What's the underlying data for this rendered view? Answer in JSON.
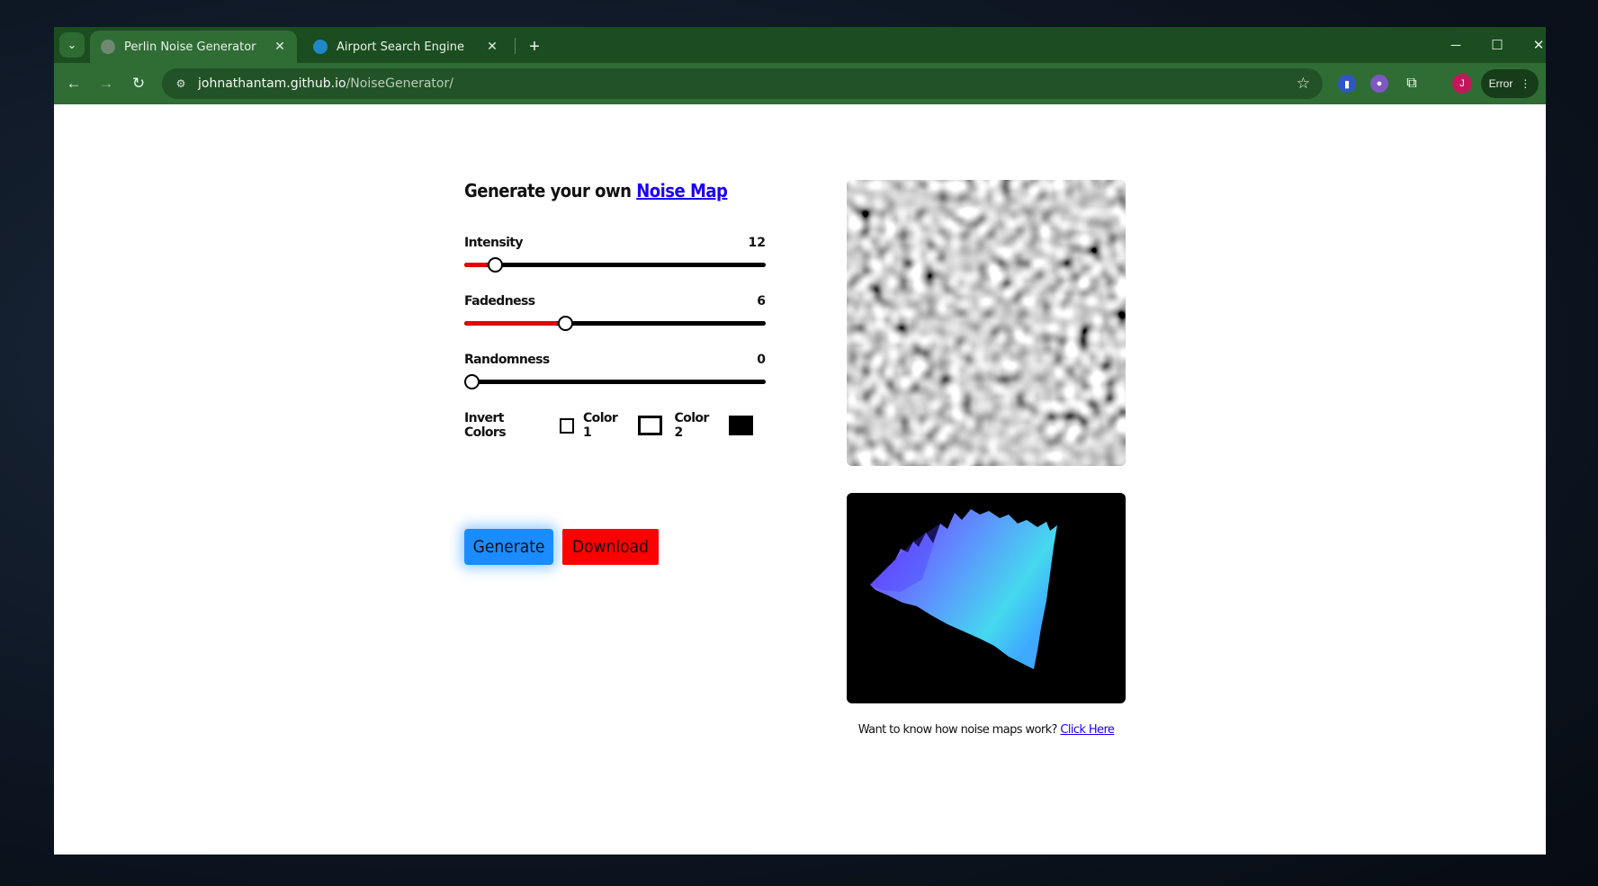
{
  "browser": {
    "tabs": [
      {
        "title": "Perlin Noise Generator",
        "active": true,
        "icon": "globe-icon"
      },
      {
        "title": "Airport Search Engine",
        "active": false,
        "icon": "x-badge-icon"
      }
    ],
    "new_tab_label": "+",
    "url_host": "johnathantam.github.io",
    "url_path": "/NoiseGenerator/",
    "profile_initial": "J",
    "error_label": "Error",
    "accent_color": "#2f6d34"
  },
  "page": {
    "heading_prefix": "Generate your own ",
    "heading_link": "Noise Map",
    "sliders": [
      {
        "label": "Intensity",
        "value": "12",
        "fraction": 0.077
      },
      {
        "label": "Fadedness",
        "value": "6",
        "fraction": 0.31
      },
      {
        "label": "Randomness",
        "value": "0",
        "fraction": 0.0
      }
    ],
    "invert_label": "Invert Colors",
    "invert_checked": false,
    "color1_label": "Color 1",
    "color1_value": "#ffffff",
    "color2_label": "Color 2",
    "color2_value": "#000000",
    "generate_label": "Generate",
    "download_label": "Download",
    "footer_text": "Want to know how noise maps work? ",
    "footer_link": "Click Here"
  }
}
